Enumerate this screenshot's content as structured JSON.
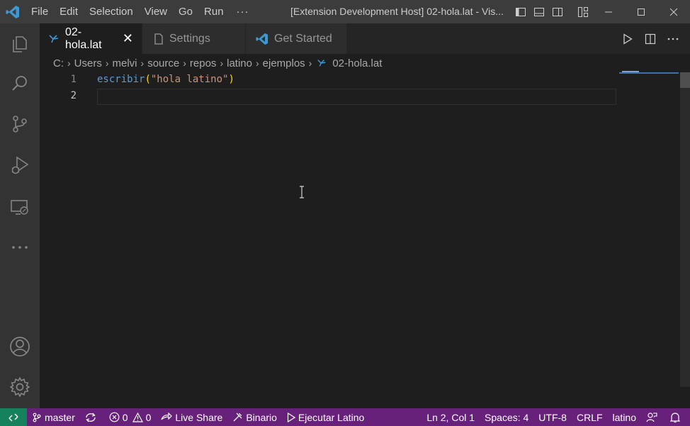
{
  "titlebar": {
    "menus": [
      "File",
      "Edit",
      "Selection",
      "View",
      "Go",
      "Run"
    ],
    "more": "···",
    "title": "[Extension Development Host] 02-hola.lat - Vis..."
  },
  "tabs": [
    {
      "label": "02-hola.lat",
      "icon": "latino-file-icon",
      "active": true
    },
    {
      "label": "Settings",
      "icon": "settings-file-icon",
      "active": false
    },
    {
      "label": "Get Started",
      "icon": "vscode-icon",
      "active": false
    }
  ],
  "breadcrumb": [
    "C:",
    "Users",
    "melvi",
    "source",
    "repos",
    "latino",
    "ejemplos",
    "02-hola.lat"
  ],
  "editor": {
    "line_numbers": [
      "1",
      "2"
    ],
    "code": {
      "fn": "escribir",
      "open": "(",
      "string": "\"hola latino\"",
      "close": ")"
    }
  },
  "statusbar": {
    "branch": "master",
    "errors": "0",
    "warnings": "0",
    "live_share": "Live Share",
    "binario": "Binario",
    "ejecutar": "Ejecutar Latino",
    "position": "Ln 2, Col 1",
    "spaces": "Spaces: 4",
    "encoding": "UTF-8",
    "eol": "CRLF",
    "language": "latino"
  },
  "colors": {
    "statusbar": "#68217a",
    "remote": "#16825d",
    "vscode_blue": "#3c99d4"
  }
}
